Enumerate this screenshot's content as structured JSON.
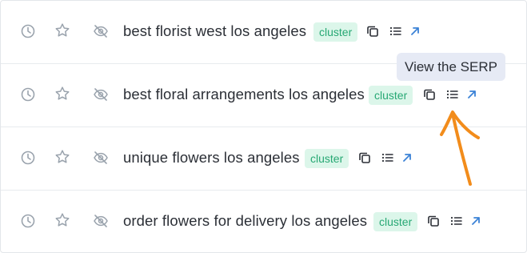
{
  "rows": [
    {
      "keyword": "best florist west los angeles",
      "badge": "cluster"
    },
    {
      "keyword": "best floral arrangements los angeles",
      "badge": "cluster"
    },
    {
      "keyword": "unique flowers los angeles",
      "badge": "cluster"
    },
    {
      "keyword": "order flowers for delivery los angeles",
      "badge": "cluster"
    }
  ],
  "tooltip": {
    "text": "View the SERP"
  },
  "colors": {
    "text": "#2b2f36",
    "icon_gray": "#9aa3ad",
    "badge_bg": "#dcf6ea",
    "badge_text": "#27a874",
    "link_blue": "#3b82d6",
    "annotation_orange": "#f28c1b",
    "tooltip_bg": "#e6eaf5"
  },
  "icons": [
    "clock-icon",
    "star-icon",
    "eye-off-icon",
    "copy-icon",
    "list-icon",
    "external-link-icon"
  ]
}
